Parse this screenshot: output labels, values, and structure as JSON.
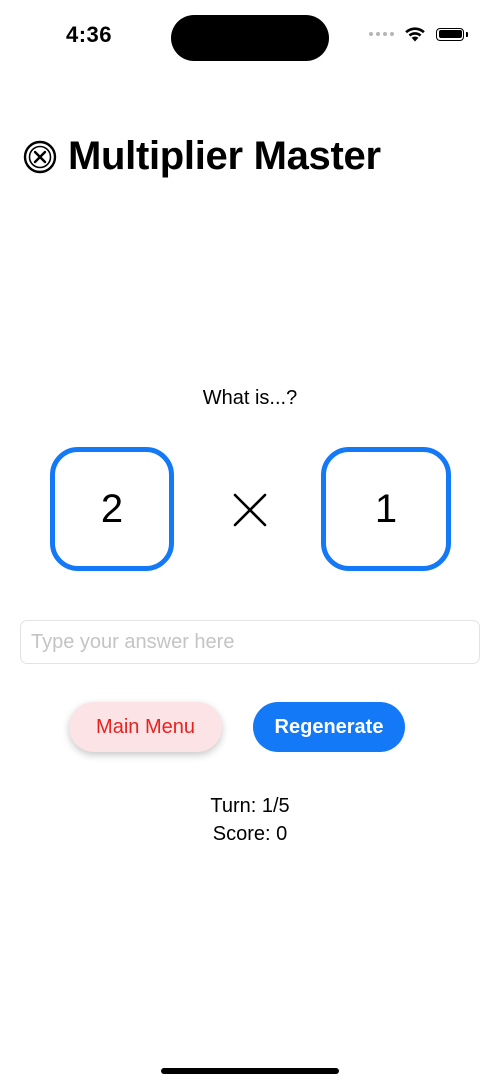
{
  "status_bar": {
    "time": "4:36",
    "icons": [
      "signal-dots-icon",
      "wifi-icon",
      "battery-icon"
    ]
  },
  "header": {
    "close_icon": "close-circle-icon",
    "title": "Multiplier Master"
  },
  "question": {
    "prompt": "What is...?",
    "left_operand": "2",
    "operator_icon": "times-icon",
    "right_operand": "1"
  },
  "answer": {
    "value": "",
    "placeholder": "Type your answer here"
  },
  "buttons": {
    "main_menu": "Main Menu",
    "regenerate": "Regenerate"
  },
  "stats": {
    "turn": "Turn: 1/5",
    "score": "Score: 0"
  },
  "colors": {
    "accent": "#1479f6",
    "menu_button_bg": "#fbe3e6",
    "menu_button_text": "#e8231f"
  }
}
